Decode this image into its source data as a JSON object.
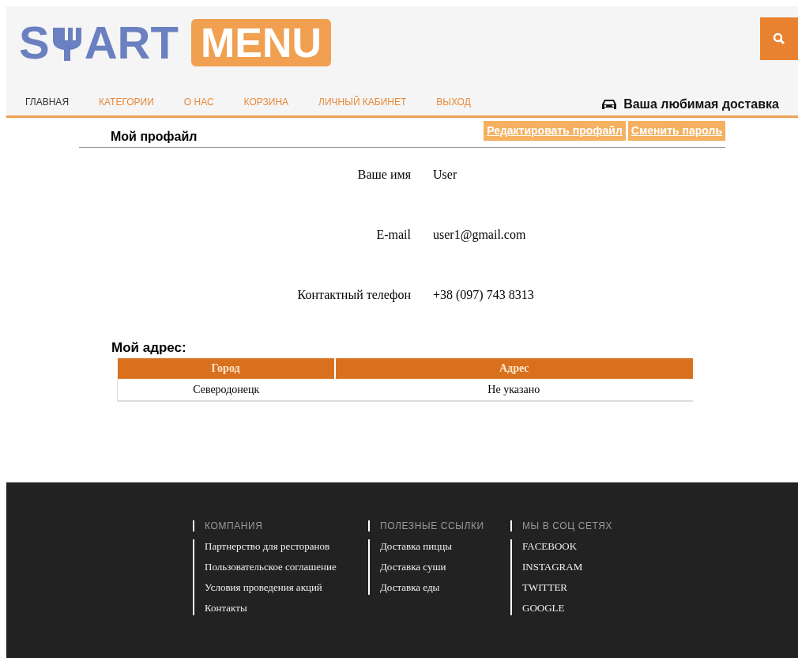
{
  "logo": {
    "start": "S",
    "end": "ART",
    "badge": "MENU"
  },
  "nav": [
    {
      "label": "ГЛАВНАЯ",
      "selected": true
    },
    {
      "label": "КАТЕГОРИИ",
      "selected": false
    },
    {
      "label": "О НАС",
      "selected": false
    },
    {
      "label": "КОРЗИНА",
      "selected": false
    },
    {
      "label": "ЛИЧНЫЙ КАБИНЕТ",
      "selected": false
    },
    {
      "label": "ВЫХОД",
      "selected": false
    }
  ],
  "tagline": "Ваша любимая доставка",
  "profile": {
    "title": "Мой профайл",
    "buttons": [
      "Редактировать профайл",
      "Сменить пароль"
    ],
    "fields": [
      {
        "label": "Ваше имя",
        "value": "User"
      },
      {
        "label": "E-mail",
        "value": "user1@gmail.com"
      },
      {
        "label": "Контактный телефон",
        "value": "+38 (097) 743 8313"
      }
    ]
  },
  "address": {
    "title": "Мой адрес:",
    "columns": [
      "Город",
      "Адрес"
    ],
    "rows": [
      [
        "Северодонецк",
        "Не указано"
      ]
    ]
  },
  "footer": {
    "columns": [
      {
        "heading": "КОМПАНИЯ",
        "links": [
          "Партнерство для ресторанов",
          "Пользовательское соглашение",
          "Условия проведения акций",
          "Контакты"
        ]
      },
      {
        "heading": "ПОЛЕЗНЫЕ ССЫЛКИ",
        "links": [
          "Доставка пиццы",
          "Доставка суши",
          "Доставка еды"
        ]
      },
      {
        "heading": "МЫ В СОЦ СЕТЯХ",
        "links": [
          "FACEBOOK",
          "INSTAGRAM",
          "TWITTER",
          "GOOGLE"
        ]
      }
    ]
  }
}
